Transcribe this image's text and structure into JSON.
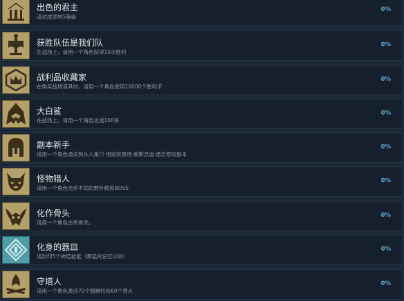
{
  "achievements": [
    {
      "title": "出色的君主",
      "desc": "请达成领地5等级",
      "percent": "0%",
      "icon": "castle-icon",
      "color": "#b3a06b"
    },
    {
      "title": "获胜队伍是我们队",
      "desc": "在战场上，请用一个角色获得10次胜利",
      "percent": "0%",
      "icon": "banner-icon",
      "color": "#b3a06b"
    },
    {
      "title": "战利品收藏家",
      "desc": "在购买战场道具时，请用一个角色使用10000个胜利币",
      "percent": "0%",
      "icon": "crown-emblem-icon",
      "color": "#b3a06b"
    },
    {
      "title": "大白鲨",
      "desc": "在战场上，请用一个角色达成100杀",
      "percent": "0%",
      "icon": "shark-icon",
      "color": "#b3a06b"
    },
    {
      "title": "副本新手",
      "desc": "请用一个角色通关狗头人巢穴·地狱贸易场·奥斯灵庙·遗忘祭坛副本",
      "percent": "0%",
      "icon": "helmet-icon",
      "color": "#b3a06b"
    },
    {
      "title": "怪物猎人",
      "desc": "请用一个角色击杀不同的野外精英BOSS",
      "percent": "0%",
      "icon": "monster-icon",
      "color": "#b3a06b"
    },
    {
      "title": "化作骨头",
      "desc": "请用一个角色击杀骨龙。",
      "percent": "0%",
      "icon": "bone-dragon-icon",
      "color": "#b3a06b"
    },
    {
      "title": "化身的器皿",
      "desc": "请封印5个神结技能（勇猛的记忆以外）",
      "percent": "0%",
      "icon": "rune-icon",
      "color": "#4f9ea6"
    },
    {
      "title": "守塔人",
      "desc": "请用一个角色激活70个图腾柱和60个营火",
      "percent": "0%",
      "icon": "campfire-icon",
      "color": "#b3a06b"
    }
  ]
}
